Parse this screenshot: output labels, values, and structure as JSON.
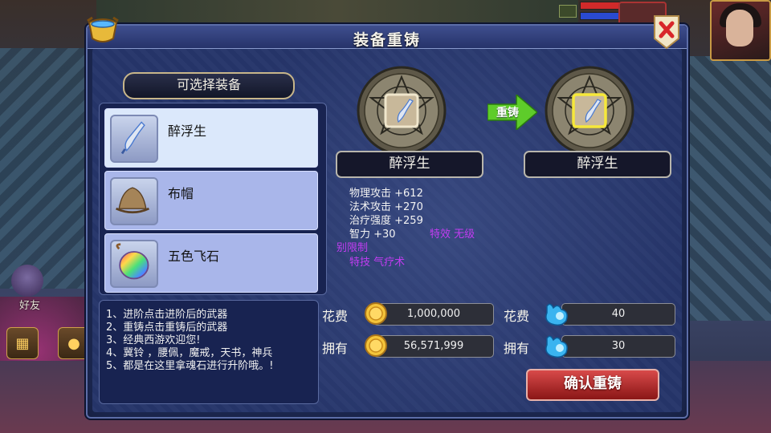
{
  "dialog": {
    "title": "装备重铸",
    "list_header": "可选择装备",
    "items": [
      {
        "name": "醉浮生",
        "icon": "blade-icon",
        "selected": true
      },
      {
        "name": "布帽",
        "icon": "cloth-hat-icon",
        "selected": false
      },
      {
        "name": "五色飞石",
        "icon": "rainbow-stone-icon",
        "selected": false
      }
    ],
    "info_lines": [
      "1、进阶点击进阶后的武器",
      "2、重铸点击重铸后的武器",
      "3、经典西游欢迎您!",
      "4、冀铃 ，腰佩，魔戒，天书，神兵",
      "5、都是在这里拿魂石进行升阶哦。!"
    ],
    "reforge": {
      "arrow_label": "重铸",
      "source_name": "醉浮生",
      "target_name": "醉浮生"
    },
    "stats": {
      "line1": "物理攻击   +612",
      "line2": "法术攻击   +270",
      "line3": "治疗强度   +259",
      "line4": "智力  +30",
      "effect": "特效  无级",
      "effect_wrap": "别限制",
      "skill": "特技  气疗术"
    },
    "cost": {
      "cost_label": "花费",
      "own_label": "拥有",
      "gold_cost": "1,000,000",
      "gold_own": "56,571,999",
      "soul_cost": "40",
      "soul_own": "30"
    },
    "confirm_label": "确认重铸"
  },
  "hud": {
    "friend_label": "好友",
    "hp_fraction": 0.9,
    "mp_fraction": 0.75
  },
  "colors": {
    "dialog_bg": "#26356a",
    "selected_item": "#dbe8fb",
    "item_bg": "#a9b6ea",
    "stat_purple": "#c23cf2",
    "confirm_red": "#c83030",
    "arrow_green": "#5ecc2a"
  }
}
